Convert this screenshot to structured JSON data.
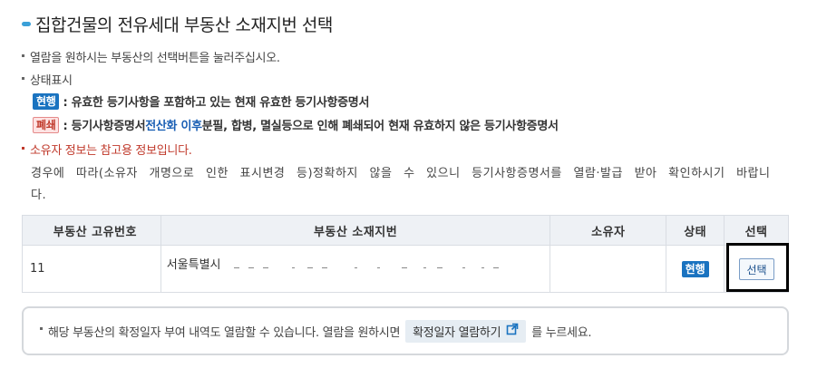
{
  "title": "집합건물의 전유세대 부동산 소재지번 선택",
  "instructions": {
    "line1": "열람을 원하시는 부동산의 선택버튼을 눌러주십시오.",
    "status_label": "상태표시",
    "current_badge": "현행",
    "current_desc": ": 유효한 등기사항을 포함하고 있는 현재 유효한 등기사항증명서",
    "closed_badge": "폐쇄",
    "closed_desc_pre": ": 등기사항증명서 ",
    "closed_desc_hl": "전산화 이후",
    "closed_desc_post": " 분필, 합병, 멸실등으로 인해 폐쇄되어 현재 유효하지 않은 등기사항증명서",
    "owner_note": "소유자 정보는 참고용 정보입니다.",
    "owner_para": "경우에 따라(소유자 개명으로 인한 표시변경 등)정확하지 않을 수 있으니 등기사항증명서를 열람·발급 받아 확인하시기 바랍니다."
  },
  "table": {
    "headers": [
      "부동산 고유번호",
      "부동산 소재지번",
      "소유자",
      "상태",
      "선택"
    ],
    "rows": [
      {
        "id": "11",
        "address": "서울특별시",
        "owner": "",
        "status": "현행",
        "select": "선택"
      }
    ]
  },
  "info_box": {
    "text_pre": "해당 부동산의 확정일자 부여 내역도 열람할 수 있습니다. 열람을 원하시면",
    "button_label": "확정일자 열람하기",
    "text_post": "를 누르세요."
  },
  "colors": {
    "accent": "#3aa0d8",
    "current_badge": "#1a73c0",
    "closed_badge_text": "#c0392b",
    "note_red": "#c0392b"
  },
  "icons": {
    "title_mark": "dash-mark-icon",
    "external_link": "external-link-icon"
  }
}
